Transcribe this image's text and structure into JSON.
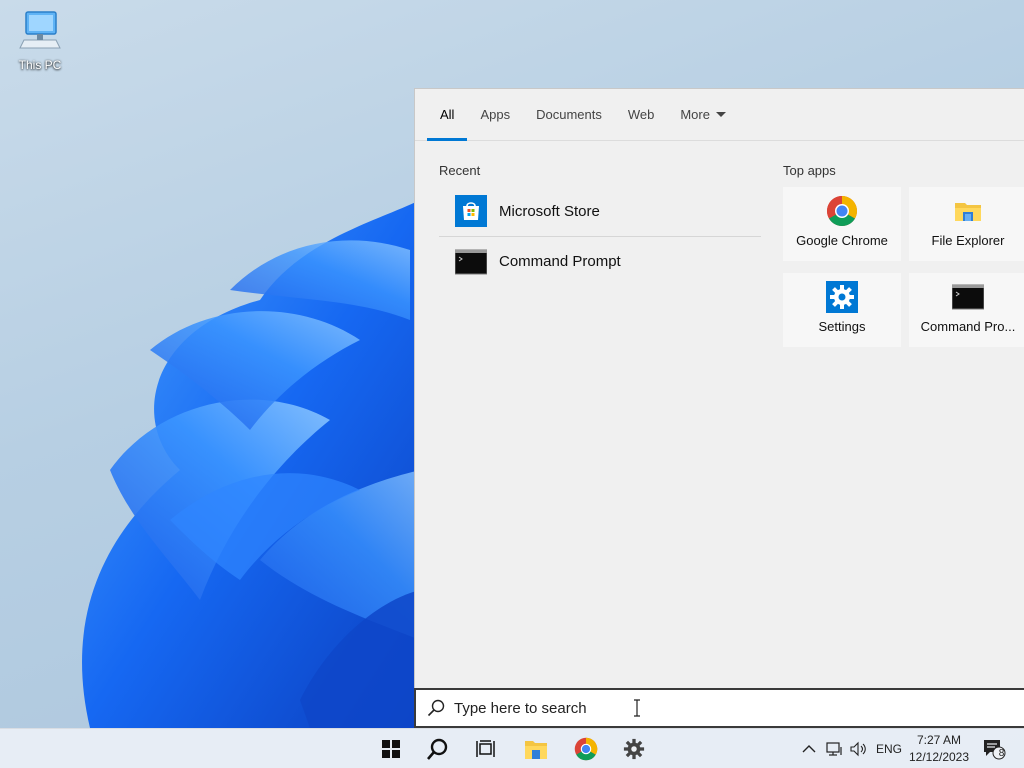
{
  "desktop": {
    "icons": [
      {
        "label": "This PC",
        "icon": "computer-icon"
      }
    ]
  },
  "search_flyout": {
    "tabs": [
      {
        "label": "All",
        "active": true
      },
      {
        "label": "Apps",
        "active": false
      },
      {
        "label": "Documents",
        "active": false
      },
      {
        "label": "Web",
        "active": false
      },
      {
        "label": "More",
        "active": false
      }
    ],
    "recent": {
      "title": "Recent",
      "items": [
        {
          "label": "Microsoft Store",
          "icon": "microsoft-store-icon"
        },
        {
          "label": "Command Prompt",
          "icon": "command-prompt-icon"
        }
      ]
    },
    "top_apps": {
      "title": "Top apps",
      "items": [
        {
          "label": "Google Chrome",
          "icon": "chrome-icon"
        },
        {
          "label": "File Explorer",
          "icon": "file-explorer-icon"
        },
        {
          "label": "Settings",
          "icon": "settings-gear-icon"
        },
        {
          "label": "Command Pro...",
          "icon": "command-prompt-icon"
        }
      ]
    }
  },
  "search_box": {
    "placeholder": "Type here to search",
    "value": ""
  },
  "taskbar": {
    "pinned": [
      "start-icon",
      "search-icon",
      "task-view-icon",
      "file-explorer-icon",
      "chrome-icon",
      "settings-gear-icon"
    ],
    "tray": {
      "language": "ENG",
      "time": "7:27 AM",
      "date": "12/12/2023",
      "notification_count": "8"
    }
  },
  "colors": {
    "accent": "#0078d4",
    "flyout_bg": "#f0f0f0",
    "wallpaper_blue": "#1a6df0"
  }
}
